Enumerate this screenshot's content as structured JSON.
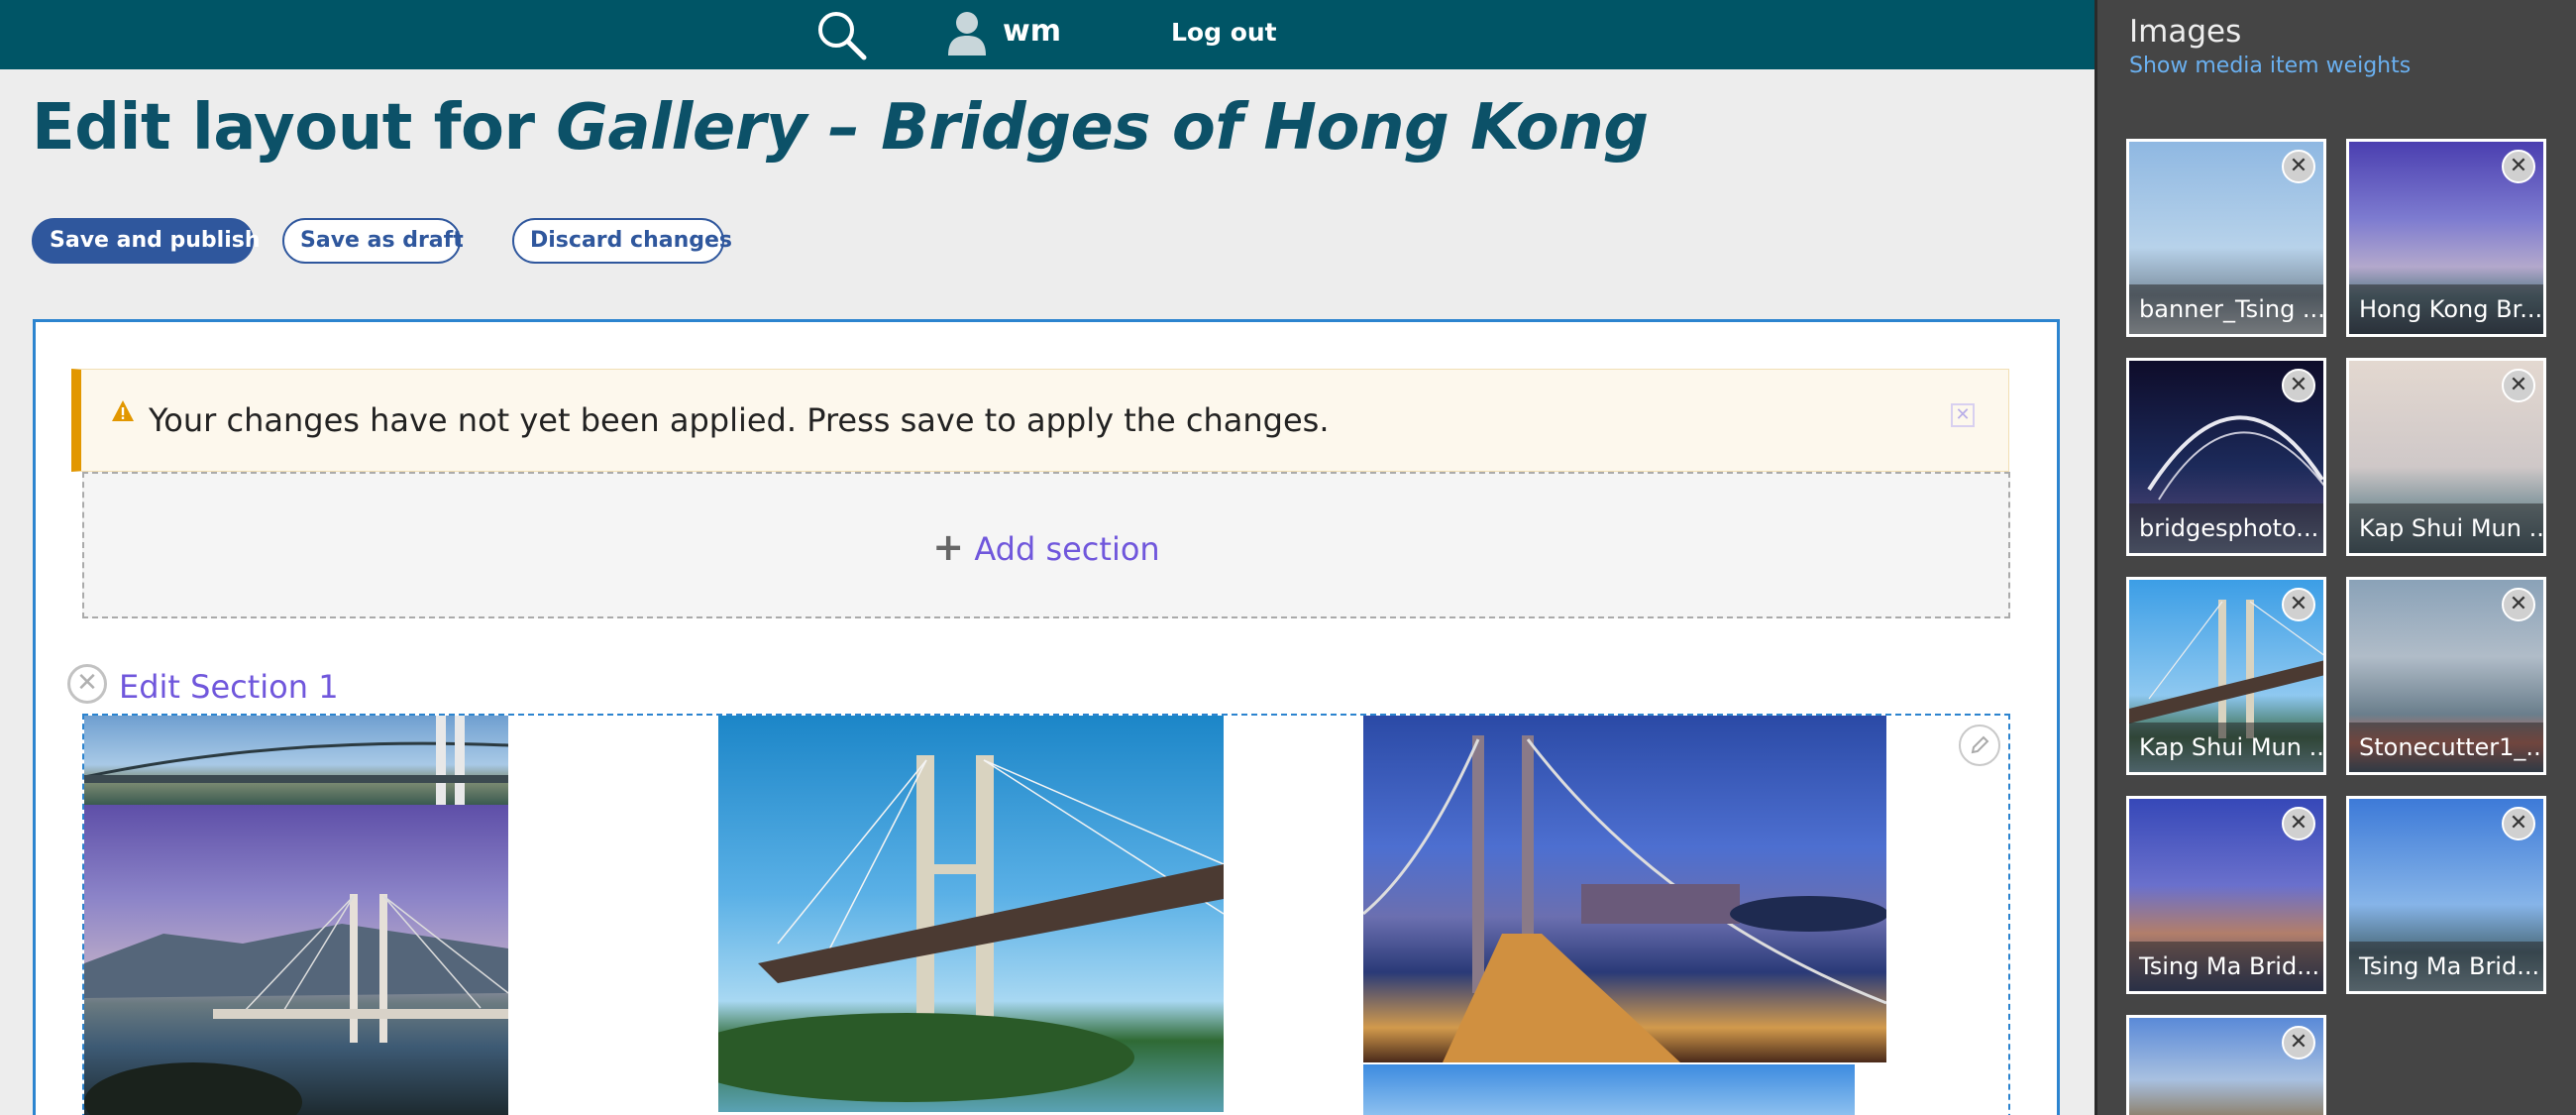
{
  "toolbar": {
    "username": "wm",
    "logout_label": "Log out"
  },
  "page": {
    "title_prefix": "Edit layout for",
    "title_node": "Gallery – Bridges of Hong Kong"
  },
  "actions": {
    "save_publish": "Save and publish",
    "save_draft": "Save as draft",
    "discard": "Discard changes"
  },
  "notice": {
    "text": "Your changes have not yet been applied. Press save to apply the changes."
  },
  "builder": {
    "add_section_label": "Add section",
    "section_label": "Edit Section 1"
  },
  "sidebar": {
    "title": "Images",
    "weights_link": "Show media item weights",
    "items": [
      {
        "label": "banner_Tsing ..."
      },
      {
        "label": "Hong Kong Br..."
      },
      {
        "label": "bridgesphoto..."
      },
      {
        "label": "Kap Shui Mun ..."
      },
      {
        "label": "Kap Shui Mun ..."
      },
      {
        "label": "Stonecutter1_..."
      },
      {
        "label": "Tsing Ma Brid..."
      },
      {
        "label": "Tsing Ma Brid..."
      }
    ]
  },
  "icons": {
    "search": "search-icon",
    "user": "user-icon",
    "warning": "warning-icon",
    "close": "close-icon",
    "plus": "plus-icon",
    "pencil": "pencil-icon"
  },
  "colors": {
    "toolbar": "#005566",
    "title": "#0c5168",
    "primary_button": "#2f579d",
    "link_purple": "#7057dc",
    "region_border": "#2c84cf",
    "notice_accent": "#e29700",
    "sidebar_bg": "#454545"
  }
}
